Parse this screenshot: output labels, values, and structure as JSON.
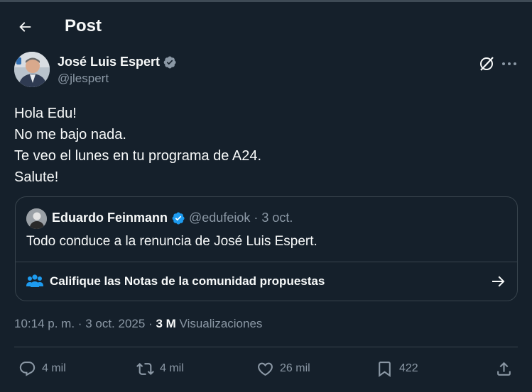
{
  "header": {
    "title": "Post",
    "back_icon": "back-arrow-icon"
  },
  "author": {
    "name": "José Luis Espert",
    "handle": "@jlespert",
    "verified_color": "#8b98a5"
  },
  "tweet": {
    "lines": [
      "Hola Edu!",
      "No me bajo nada.",
      "Te veo el lunes en tu programa de A24.",
      "Salute!"
    ]
  },
  "quote": {
    "name": "Eduardo Feinmann",
    "handle": "@edufeiok",
    "separator": "·",
    "date": "3 oct.",
    "text": "Todo conduce a la renuncia de José Luis Espert.",
    "verified_color": "#1d9bf0",
    "community_notes_label": "Califique las Notas de la comunidad propuestas"
  },
  "meta": {
    "time": "10:14 p. m.",
    "separator": "·",
    "date": "3 oct. 2025",
    "views_count": "3 M",
    "views_label": "Visualizaciones"
  },
  "actions": {
    "replies": "4 mil",
    "reposts": "4 mil",
    "likes": "26 mil",
    "bookmarks": "422"
  },
  "colors": {
    "background": "#15202b",
    "border": "#38444d",
    "secondary_text": "#8b98a5",
    "accent": "#1d9bf0"
  }
}
